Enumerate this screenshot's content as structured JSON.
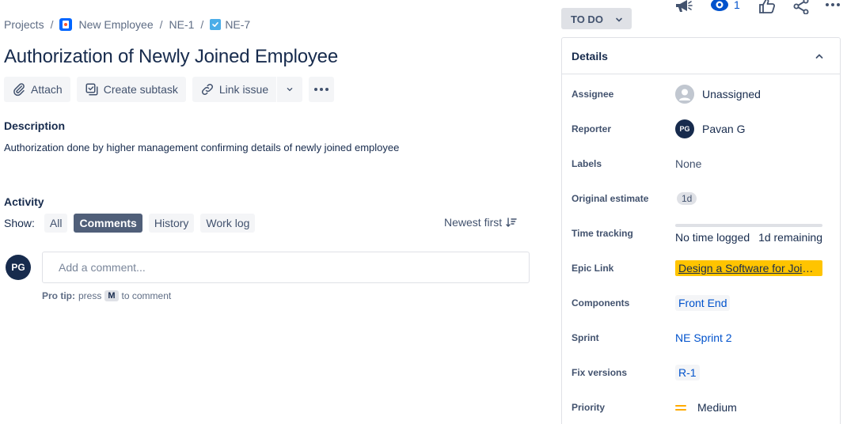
{
  "breadcrumb": {
    "projects": "Projects",
    "project_name": "New Employee",
    "parent_key": "NE-1",
    "issue_key": "NE-7",
    "separator": "/"
  },
  "issue": {
    "title": "Authorization of Newly Joined Employee"
  },
  "toolbar": {
    "attach": "Attach",
    "create_subtask": "Create subtask",
    "link_issue": "Link issue"
  },
  "description": {
    "heading": "Description",
    "text": "Authorization done by higher management confirming details of newly joined employee"
  },
  "activity": {
    "heading": "Activity",
    "show_label": "Show:",
    "filters": [
      "All",
      "Comments",
      "History",
      "Work log"
    ],
    "active_filter": "Comments",
    "sort": "Newest first"
  },
  "comment": {
    "avatar_initials": "PG",
    "placeholder": "Add a comment...",
    "pro_tip_label": "Pro tip:",
    "pro_tip_press": "press",
    "pro_tip_key": "M",
    "pro_tip_suffix": "to comment"
  },
  "top_actions": {
    "watchers_count": "1"
  },
  "status": {
    "label": "To Do"
  },
  "details": {
    "header": "Details",
    "fields": {
      "assignee": {
        "label": "Assignee",
        "value": "Unassigned"
      },
      "reporter": {
        "label": "Reporter",
        "value": "Pavan G",
        "initials": "PG"
      },
      "labels": {
        "label": "Labels",
        "value": "None"
      },
      "original_estimate": {
        "label": "Original estimate",
        "value": "1d"
      },
      "time_tracking": {
        "label": "Time tracking",
        "logged": "No time logged",
        "remaining": "1d remaining"
      },
      "epic_link": {
        "label": "Epic Link",
        "value": "Design a Software for Joini..."
      },
      "components": {
        "label": "Components",
        "value": "Front End"
      },
      "sprint": {
        "label": "Sprint",
        "value": "NE Sprint 2"
      },
      "fix_versions": {
        "label": "Fix versions",
        "value": "R-1"
      },
      "priority": {
        "label": "Priority",
        "value": "Medium"
      }
    }
  },
  "colors": {
    "primary_text": "#172b4d",
    "link": "#0052cc",
    "epic": "#ffc400",
    "priority_medium": "#ffab00",
    "active_filter_bg": "#505f79"
  }
}
